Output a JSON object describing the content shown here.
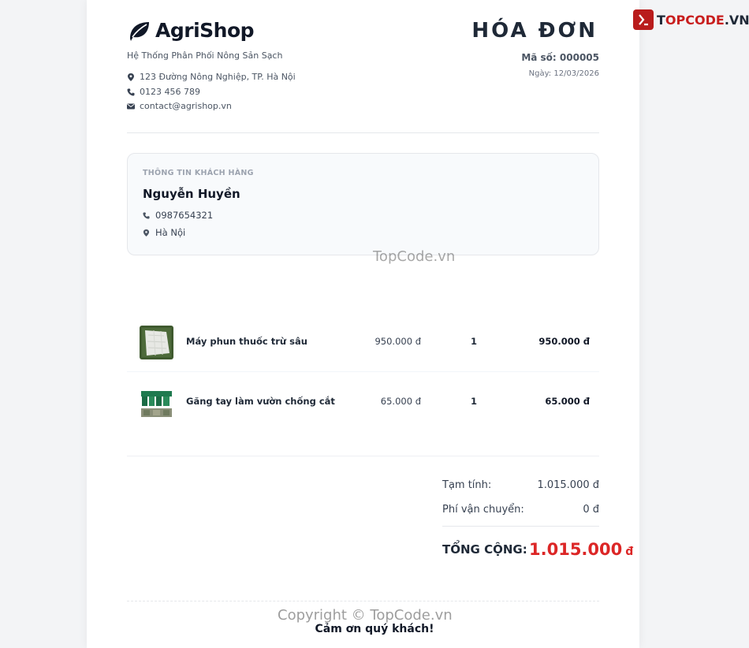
{
  "company": {
    "name": "AgriShop",
    "tagline": "Hệ Thống Phân Phối Nông Sản Sạch",
    "address": "123 Đường Nông Nghiệp, TP. Hà Nội",
    "phone": "0123 456 789",
    "email": "contact@agrishop.vn"
  },
  "invoice": {
    "title": "HÓA ĐƠN",
    "number": "Mã số: 000005",
    "date": "Ngày: 12/03/2026"
  },
  "customer": {
    "section_label": "THÔNG TIN KHÁCH HÀNG",
    "name": "Nguyễn Huyền",
    "phone": "0987654321",
    "address": "Hà Nội"
  },
  "items": [
    {
      "name": "Máy phun thuốc trừ sâu",
      "price": "950.000 đ",
      "qty": "1",
      "total": "950.000 đ",
      "image_icon": "sprayer-product-image"
    },
    {
      "name": "Găng tay làm vườn chống cắt",
      "price": "65.000 đ",
      "qty": "1",
      "total": "65.000 đ",
      "image_icon": "gloves-product-image"
    }
  ],
  "summary": {
    "subtotal_label": "Tạm tính:",
    "subtotal_value": "1.015.000 đ",
    "shipping_label": "Phí vận chuyển:",
    "shipping_value": "0 đ",
    "grand_label": "TỔNG CỘNG:",
    "grand_value": "1.015.000",
    "grand_currency": "đ"
  },
  "footer": {
    "thanks": "Cảm ơn quý khách!"
  },
  "watermarks": {
    "center": "TopCode.vn",
    "bottom": "Copyright © TopCode.vn"
  },
  "topcode_logo": {
    "prefix": "T",
    "accent": "OPCODE",
    "suffix": ".VN"
  },
  "colors": {
    "accent_red": "#dc2626",
    "text_dark": "#111827",
    "box_bg": "#f8fafc"
  }
}
